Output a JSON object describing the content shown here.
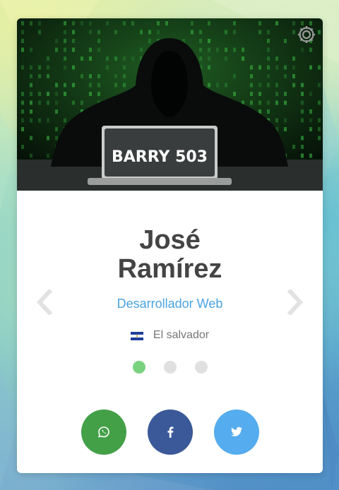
{
  "profile": {
    "cover_text": "BARRY 503",
    "first_name": "José",
    "last_name": "Ramírez",
    "role": "Desarrollador Web",
    "location": "El salvador"
  },
  "carousel": {
    "active_index": 0,
    "count": 3
  },
  "icons": {
    "settings": "gear-icon",
    "prev": "chevron-left-icon",
    "next": "chevron-right-icon",
    "flag": "el-salvador-flag-icon",
    "whatsapp": "whatsapp-icon",
    "facebook": "facebook-icon",
    "twitter": "twitter-icon"
  },
  "colors": {
    "role": "#4aa3df",
    "dot_active": "#78d27e",
    "whatsapp": "#43a047",
    "facebook": "#3b5998",
    "twitter": "#55acee"
  }
}
